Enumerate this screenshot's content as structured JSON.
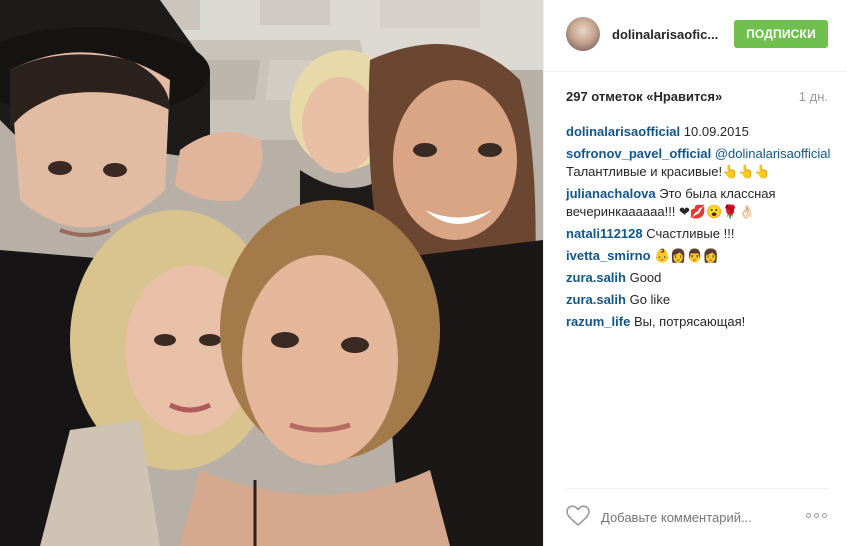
{
  "post": {
    "photo_alt": "Селфи группы людей",
    "header": {
      "username": "dolinalarisaofic...",
      "follow_label": "ПОДПИСКИ",
      "follow_color": "#70c050"
    },
    "likes": {
      "text": "297 отметок «Нравится»",
      "time": "1 дн."
    },
    "comments": [
      {
        "user": "dolinalarisaofficial",
        "text": "10.09.2015"
      },
      {
        "user": "sofronov_pavel_official",
        "mention": "@dolinalarisaofficial",
        "text": "Талантливые и красивые!👆👆👆"
      },
      {
        "user": "julianachalova",
        "text": "Это была классная вечеринкаааааа!!! ❤💋😮🌹👌🏻"
      },
      {
        "user": "natali112128",
        "text": "Счастливые !!!"
      },
      {
        "user": "ivetta_smirno",
        "text": "👶👩👨👩"
      },
      {
        "user": "zura.salih",
        "text": "Good"
      },
      {
        "user": "zura.salih",
        "text": "Go like"
      },
      {
        "user": "razum_life",
        "text": "Вы, потрясающая!"
      }
    ],
    "footer": {
      "comment_placeholder": "Добавьте комментарий...",
      "heart_icon": "heart-outline-icon",
      "more_icon": "more-dots-icon"
    }
  }
}
